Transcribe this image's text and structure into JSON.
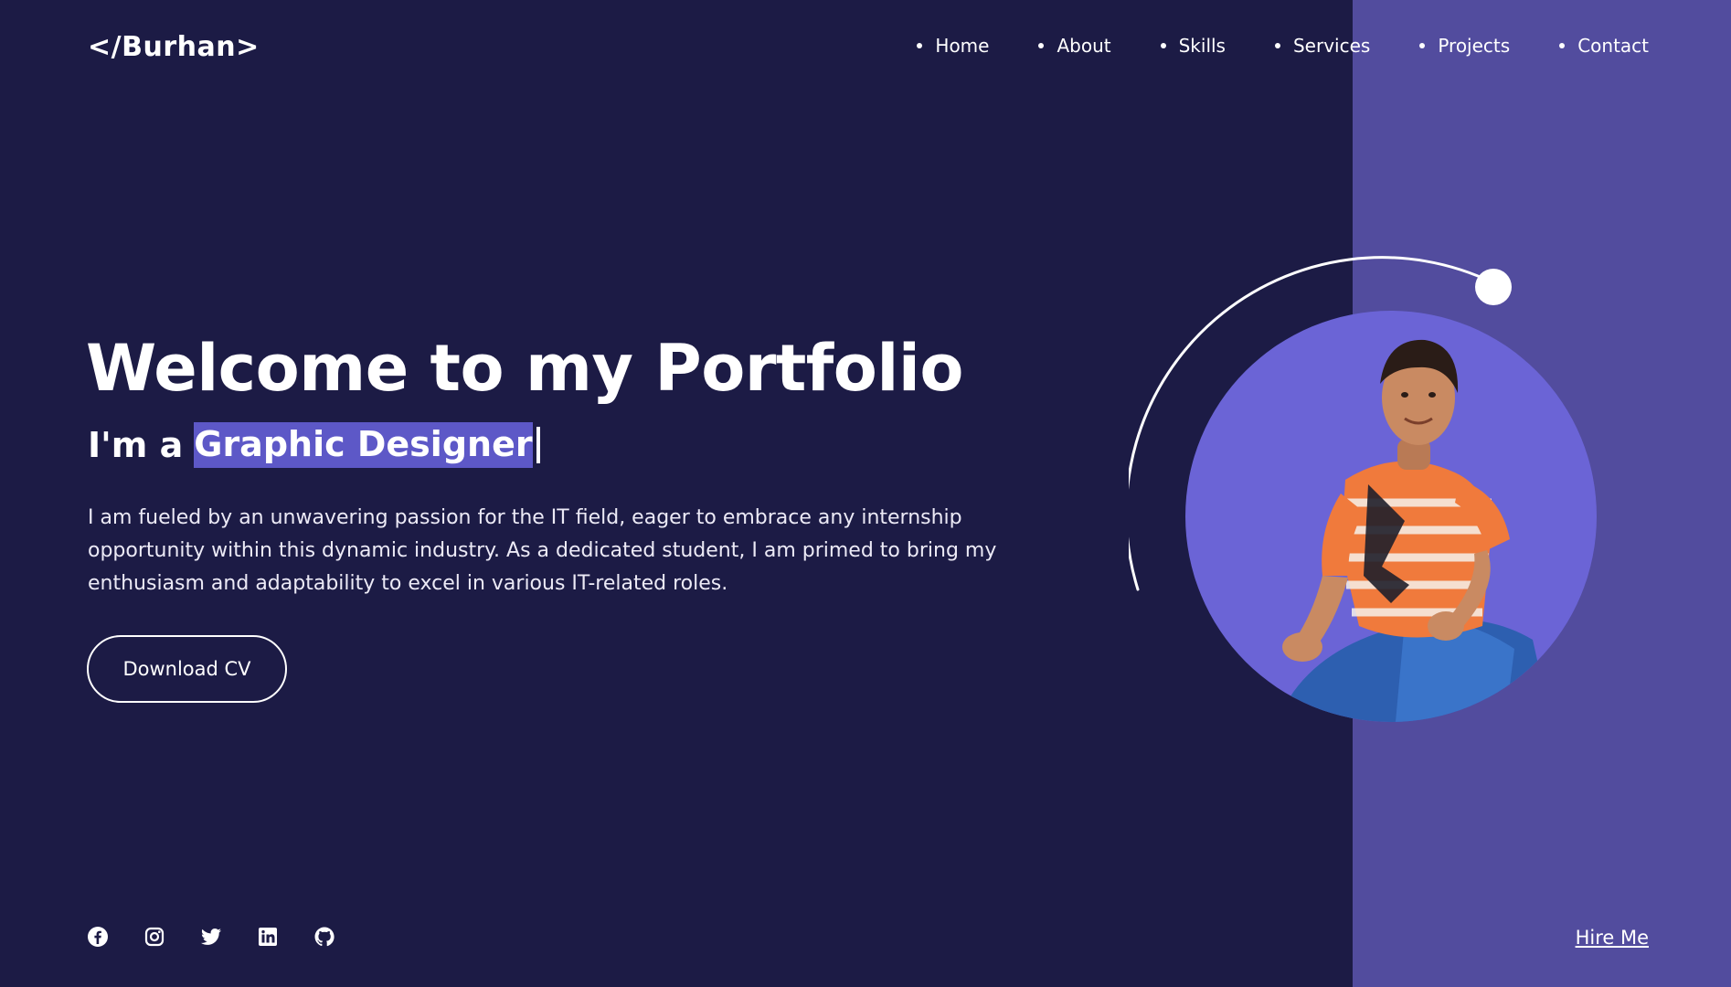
{
  "header": {
    "logo": "</Burhan>",
    "nav": [
      {
        "label": "Home"
      },
      {
        "label": "About"
      },
      {
        "label": "Skills"
      },
      {
        "label": "Services"
      },
      {
        "label": "Projects"
      },
      {
        "label": "Contact"
      }
    ]
  },
  "hero": {
    "title": "Welcome to my Portfolio",
    "subtitle_prefix": "I'm a",
    "role": "Graphic Designer",
    "bio": "I am fueled by an unwavering passion for the IT field, eager to embrace any internship opportunity within this dynamic industry. As a dedicated student, I am primed to bring my enthusiasm and adaptability to excel in various IT-related roles.",
    "cta_label": "Download CV"
  },
  "footer": {
    "socials": [
      "facebook-icon",
      "instagram-icon",
      "twitter-icon",
      "linkedin-icon",
      "github-icon"
    ],
    "hire_label": "Hire Me"
  },
  "colors": {
    "background": "#1c1b45",
    "accent_panel": "#524c9e",
    "highlight": "#5d58c7",
    "portrait_bg": "#6b64d6"
  }
}
